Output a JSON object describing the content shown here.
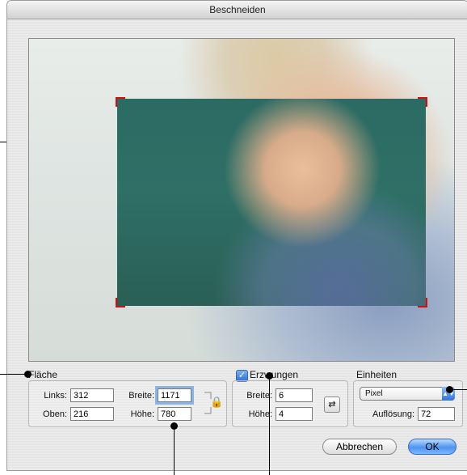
{
  "window": {
    "title": "Beschneiden"
  },
  "flaeche": {
    "title": "Fläche",
    "links_label": "Links:",
    "links_value": "312",
    "oben_label": "Oben:",
    "oben_value": "216",
    "breite_label": "Breite:",
    "breite_value": "1171",
    "hoehe_label": "Höhe:",
    "hoehe_value": "780"
  },
  "erzwungen": {
    "label": "Erzwungen",
    "checked": true,
    "breite_label": "Breite:",
    "breite_value": "6",
    "hoehe_label": "Höhe:",
    "hoehe_value": "4"
  },
  "einheiten": {
    "title": "Einheiten",
    "unit_selected": "Pixel",
    "aufloesung_label": "Auflösung:",
    "aufloesung_value": "72"
  },
  "buttons": {
    "cancel": "Abbrechen",
    "ok": "OK"
  },
  "icons": {
    "checkbox": "checkmark-icon",
    "swap": "swap-ratio-icon",
    "lock": "lock-icon",
    "select_arrow": "updown-arrow-icon"
  },
  "colors": {
    "crop_handle": "#d01010",
    "default_button": "#4f93ee",
    "field_focus": "#8ab3e6"
  }
}
